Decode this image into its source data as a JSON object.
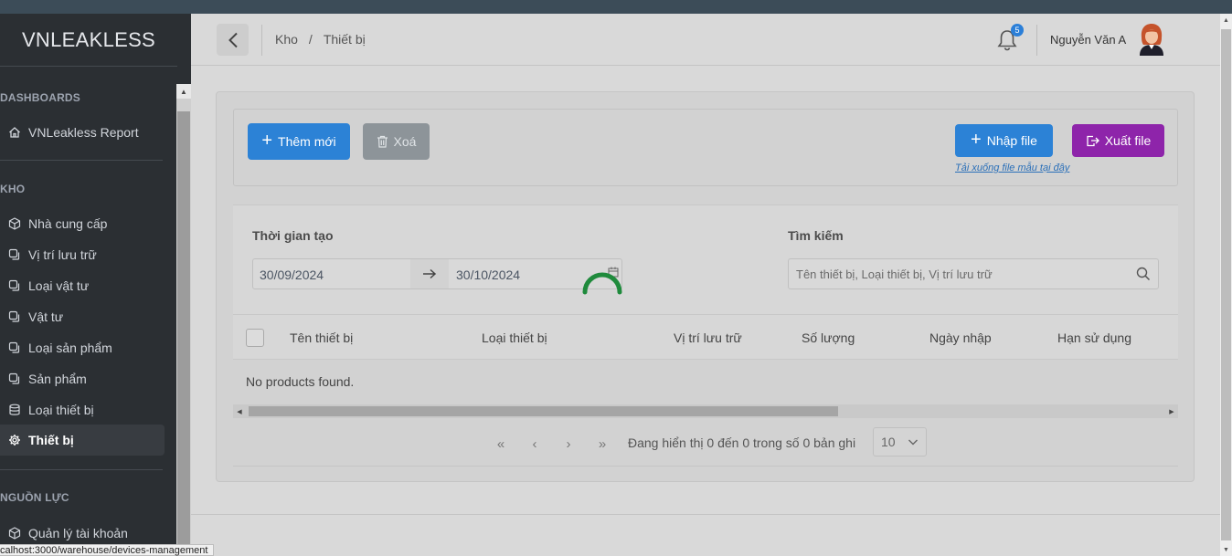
{
  "app": {
    "logo": "VNLEAKLESS"
  },
  "sidebar": {
    "sections": [
      {
        "title": "DASHBOARDS"
      },
      {
        "title": "KHO"
      },
      {
        "title": "NGUỒN LỰC"
      }
    ],
    "dashboard_items": [
      {
        "label": "VNLeakless Report",
        "icon": "home-icon"
      }
    ],
    "kho_items": [
      {
        "label": "Nhà cung cấp",
        "icon": "box-icon"
      },
      {
        "label": "Vị trí lưu trữ",
        "icon": "copy-icon"
      },
      {
        "label": "Loại vật tư",
        "icon": "copy-icon"
      },
      {
        "label": "Vật tư",
        "icon": "copy-icon"
      },
      {
        "label": "Loại sản phẩm",
        "icon": "copy-icon"
      },
      {
        "label": "Sản phẩm",
        "icon": "copy-icon"
      },
      {
        "label": "Loại thiết bị",
        "icon": "database-icon"
      },
      {
        "label": "Thiết bị",
        "icon": "gear-icon",
        "active": true
      }
    ],
    "resource_items": [
      {
        "label": "Quản lý tài khoản",
        "icon": "box-icon"
      }
    ]
  },
  "header": {
    "breadcrumb": [
      "Kho",
      "/",
      "Thiết bị"
    ],
    "notification_count": "5",
    "user_name": "Nguyễn Văn A"
  },
  "toolbar": {
    "add_label": "Thêm mới",
    "delete_label": "Xoá",
    "import_label": "Nhập file",
    "export_label": "Xuất file",
    "download_template": "Tải xuống file mẫu tại đây"
  },
  "filters": {
    "created_time_label": "Thời gian tạo",
    "date_from": "30/09/2024",
    "date_to": "30/10/2024",
    "search_label": "Tìm kiếm",
    "search_placeholder": "Tên thiết bị, Loại thiết bị, Vị trí lưu trữ",
    "search_value": ""
  },
  "table": {
    "columns": [
      "Tên thiết bị",
      "Loại thiết bị",
      "Vị trí lưu trữ",
      "Số lượng",
      "Ngày nhập",
      "Hạn sử dụng"
    ],
    "empty_message": "No products found."
  },
  "pagination": {
    "first": "«",
    "prev": "‹",
    "next": "›",
    "last": "»",
    "info": "Đang hiển thị 0 đến 0 trong số 0 bản ghi",
    "page_size": "10"
  },
  "status_bar": {
    "url": "calhost:3000/warehouse/devices-management"
  },
  "colors": {
    "primary": "#2c82d6",
    "export": "#8e24aa",
    "sidebar_bg": "#2b2f33",
    "spinner": "#1f8a3c",
    "badge": "#2b7fd8"
  }
}
